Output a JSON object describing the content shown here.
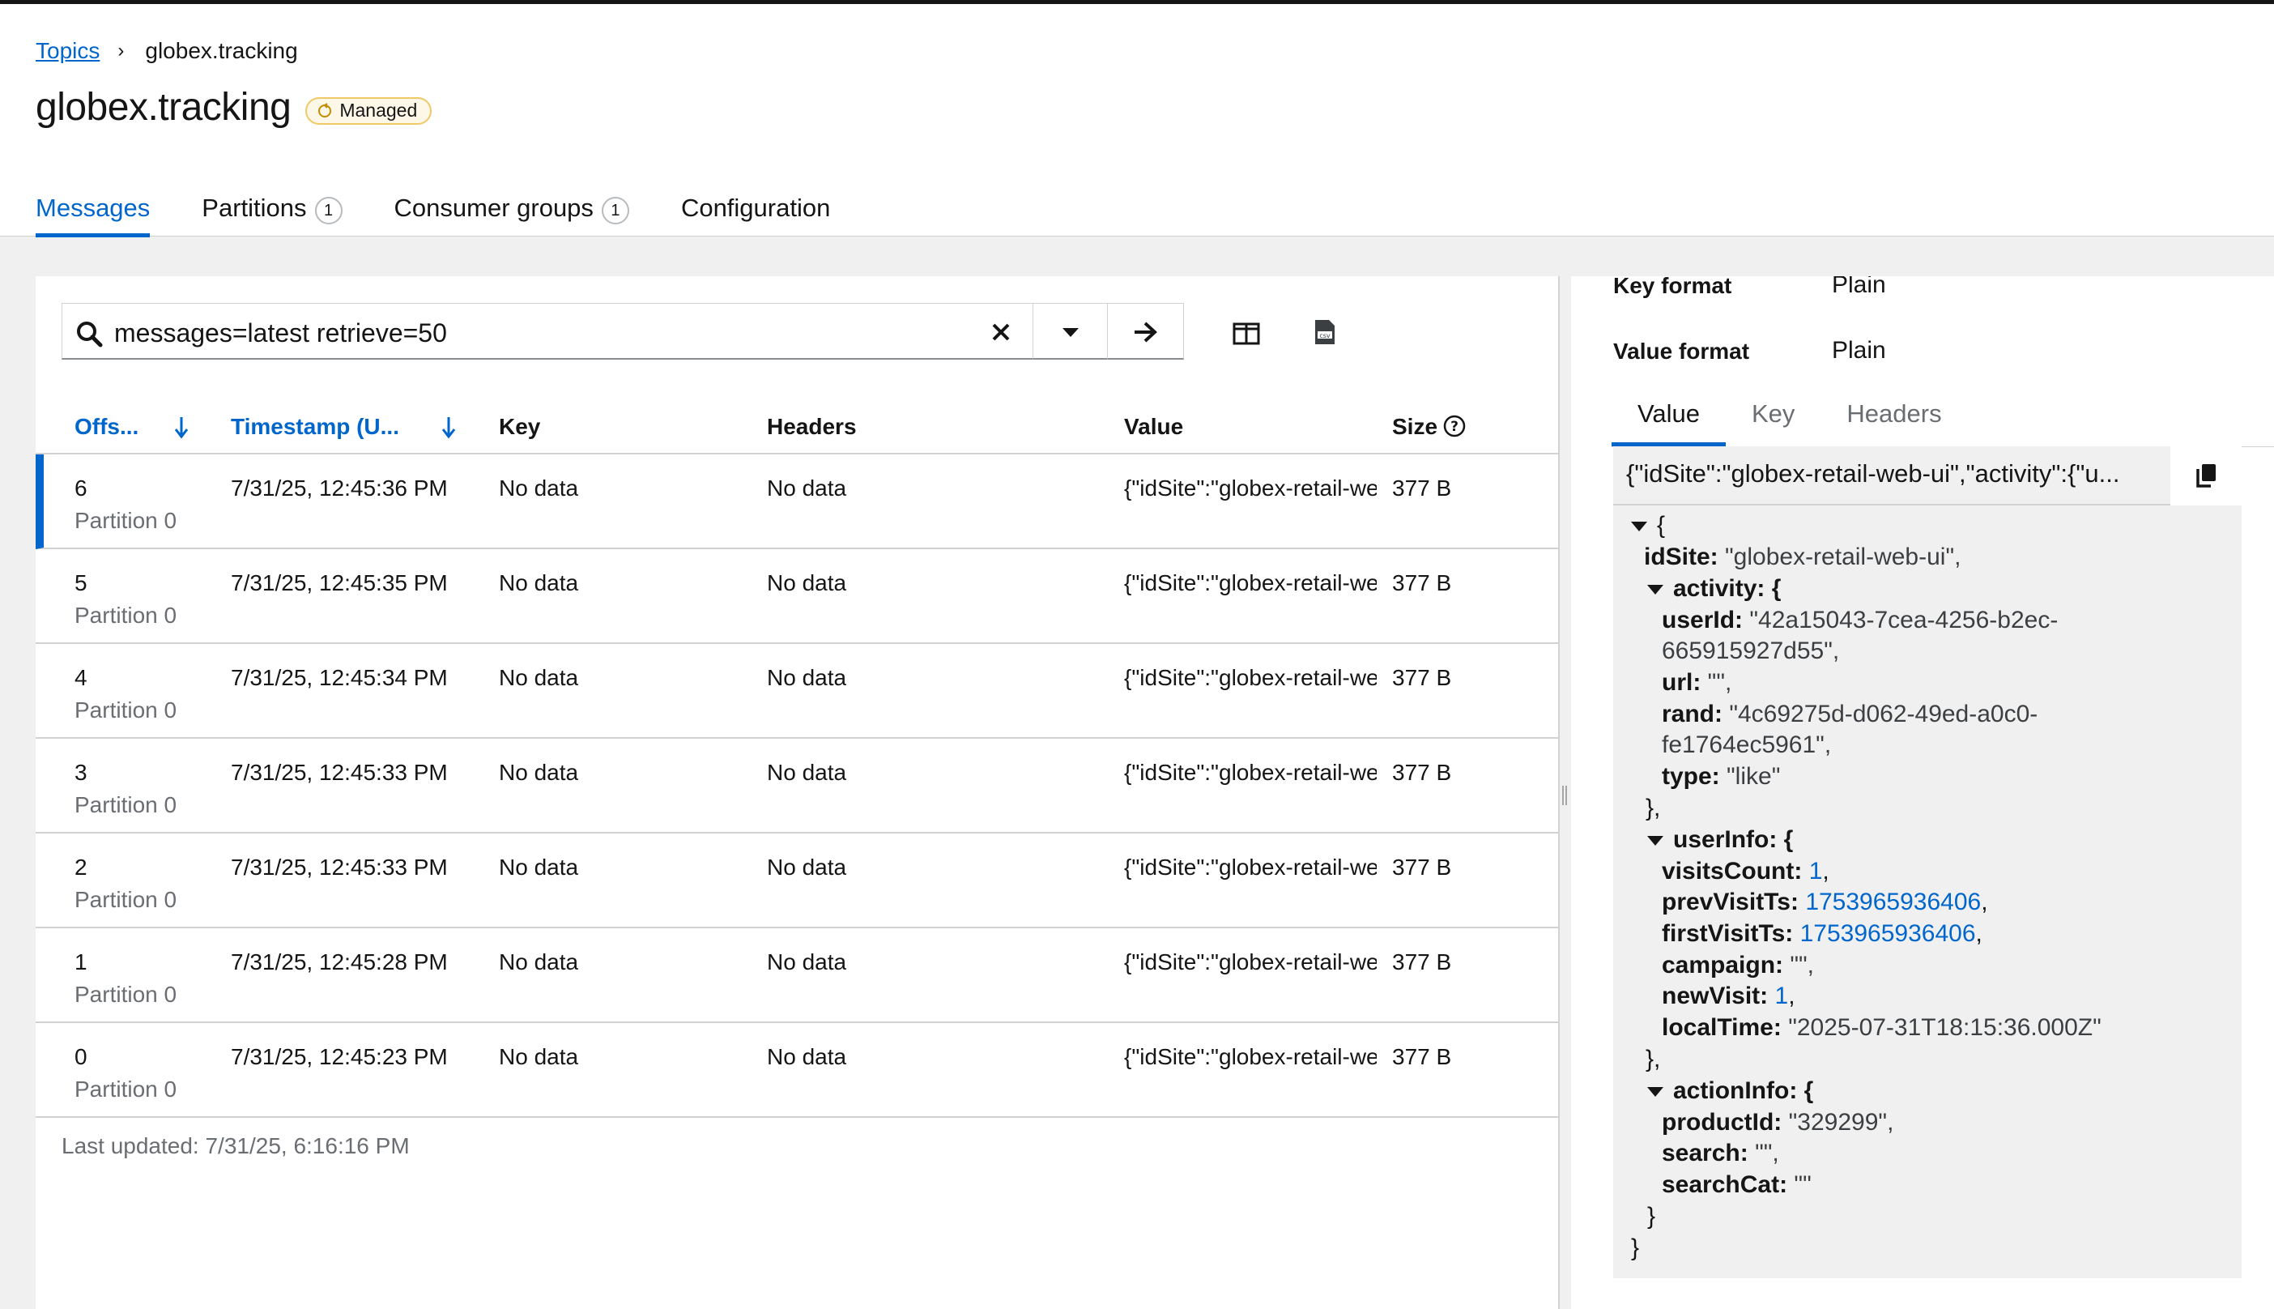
{
  "breadcrumb": {
    "parent": "Topics",
    "current": "globex.tracking"
  },
  "title": "globex.tracking",
  "badge": {
    "label": "Managed"
  },
  "tabs": [
    {
      "label": "Messages"
    },
    {
      "label": "Partitions",
      "count": "1"
    },
    {
      "label": "Consumer groups",
      "count": "1"
    },
    {
      "label": "Configuration"
    }
  ],
  "search": {
    "value": "messages=latest retrieve=50"
  },
  "table": {
    "headers": {
      "offset": "Offs...",
      "timestamp": "Timestamp (U...",
      "key": "Key",
      "headers": "Headers",
      "value": "Value",
      "size": "Size"
    },
    "rows": [
      {
        "offset": "6",
        "partition": "Partition 0",
        "timestamp": "7/31/25, 12:45:36 PM",
        "key": "No data",
        "headers": "No data",
        "value": "{\"idSite\":\"globex-retail-web-ui\"",
        "size": "377 B"
      },
      {
        "offset": "5",
        "partition": "Partition 0",
        "timestamp": "7/31/25, 12:45:35 PM",
        "key": "No data",
        "headers": "No data",
        "value": "{\"idSite\":\"globex-retail-web-ui\"",
        "size": "377 B"
      },
      {
        "offset": "4",
        "partition": "Partition 0",
        "timestamp": "7/31/25, 12:45:34 PM",
        "key": "No data",
        "headers": "No data",
        "value": "{\"idSite\":\"globex-retail-web-ui\"",
        "size": "377 B"
      },
      {
        "offset": "3",
        "partition": "Partition 0",
        "timestamp": "7/31/25, 12:45:33 PM",
        "key": "No data",
        "headers": "No data",
        "value": "{\"idSite\":\"globex-retail-web-ui\"",
        "size": "377 B"
      },
      {
        "offset": "2",
        "partition": "Partition 0",
        "timestamp": "7/31/25, 12:45:33 PM",
        "key": "No data",
        "headers": "No data",
        "value": "{\"idSite\":\"globex-retail-web-ui\"",
        "size": "377 B"
      },
      {
        "offset": "1",
        "partition": "Partition 0",
        "timestamp": "7/31/25, 12:45:28 PM",
        "key": "No data",
        "headers": "No data",
        "value": "{\"idSite\":\"globex-retail-web-ui\"",
        "size": "377 B"
      },
      {
        "offset": "0",
        "partition": "Partition 0",
        "timestamp": "7/31/25, 12:45:23 PM",
        "key": "No data",
        "headers": "No data",
        "value": "{\"idSite\":\"globex-retail-web-ui\"",
        "size": "377 B"
      }
    ]
  },
  "last_updated": "Last updated: 7/31/25, 6:16:16 PM",
  "details": {
    "key_format_label": "Key format",
    "key_format_value": "Plain",
    "value_format_label": "Value format",
    "value_format_value": "Plain",
    "tabs": [
      "Value",
      "Key",
      "Headers"
    ],
    "value_preview": "{\"idSite\":\"globex-retail-web-ui\",\"activity\":{\"u...",
    "json": {
      "open": "{",
      "idSite_key": "idSite:",
      "idSite_val": "\"globex-retail-web-ui\",",
      "activity_key": "activity: {",
      "userId_key": "userId:",
      "userId_val1": "\"42a15043-7cea-4256-b2ec-",
      "userId_val2": "665915927d55\",",
      "url_key": "url:",
      "url_val": "\"\",",
      "rand_key": "rand:",
      "rand_val1": "\"4c69275d-d062-49ed-a0c0-",
      "rand_val2": "fe1764ec5961\",",
      "type_key": "type:",
      "type_val": "\"like\"",
      "close_inner1": "},",
      "userInfo_key": "userInfo: {",
      "visitsCount_key": "visitsCount:",
      "visitsCount_val": "1",
      "prevVisitTs_key": "prevVisitTs:",
      "prevVisitTs_val": "1753965936406",
      "firstVisitTs_key": "firstVisitTs:",
      "firstVisitTs_val": "1753965936406",
      "campaign_key": "campaign:",
      "campaign_val": "\"\",",
      "newVisit_key": "newVisit:",
      "newVisit_val": "1",
      "localTime_key": "localTime:",
      "localTime_val": "\"2025-07-31T18:15:36.000Z\"",
      "close_inner2": "},",
      "actionInfo_key": "actionInfo: {",
      "productId_key": "productId:",
      "productId_val": "\"329299\",",
      "search_key": "search:",
      "search_val": "\"\",",
      "searchCat_key": "searchCat:",
      "searchCat_val": "\"\"",
      "close_inner3": "}",
      "close": "}",
      "comma": ","
    }
  }
}
